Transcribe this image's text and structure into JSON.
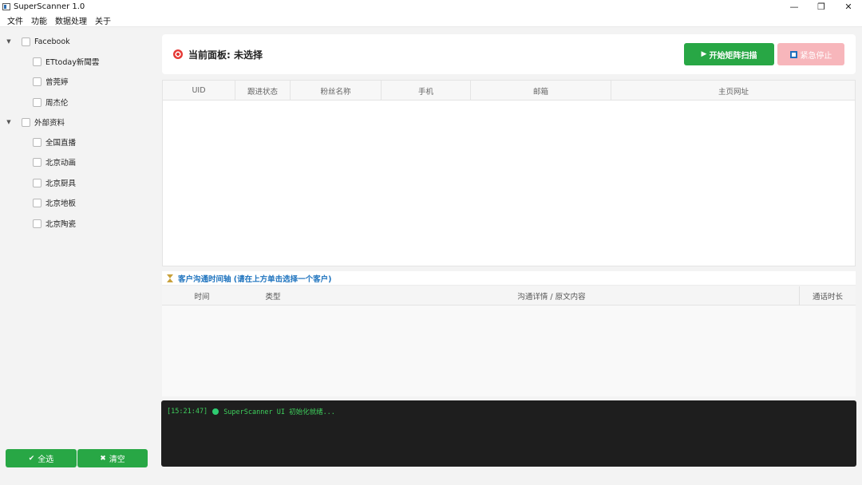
{
  "window": {
    "title": "SuperScanner 1.0",
    "minimize": "—",
    "maximize": "❐",
    "close": "✕"
  },
  "menu": [
    "文件",
    "功能",
    "数据处理",
    "关于"
  ],
  "sidebar": {
    "groups": [
      {
        "label": "Facebook",
        "items": [
          "ETtoday新聞雲",
          "曾莞婷",
          "周杰伦"
        ]
      },
      {
        "label": "外部资料",
        "items": [
          "全国直播",
          "北京动画",
          "北京厨具",
          "北京地板",
          "北京陶瓷"
        ]
      }
    ],
    "select_all": "全选",
    "clear": "清空"
  },
  "header": {
    "title": "当前面板: 未选择",
    "start_button": "开始矩阵扫描",
    "stop_button": "紧急停止"
  },
  "table": {
    "columns": [
      "UID",
      "跟进状态",
      "粉丝名称",
      "手机",
      "邮箱",
      "主页网址"
    ]
  },
  "timeline": {
    "title": "客户沟通时间轴 (请在上方单击选择一个客户)",
    "columns": [
      "时间",
      "类型",
      "沟通详情 / 原文内容",
      "通话时长"
    ]
  },
  "console": {
    "time": "[15:21:47]",
    "message": "SuperScanner UI 初始化就绪..."
  },
  "colors": {
    "accent": "#28a745",
    "stop": "#f7b6bb",
    "link": "#1e73be",
    "console_bg": "#1e1e1e",
    "console_text": "#3ecf5c"
  }
}
